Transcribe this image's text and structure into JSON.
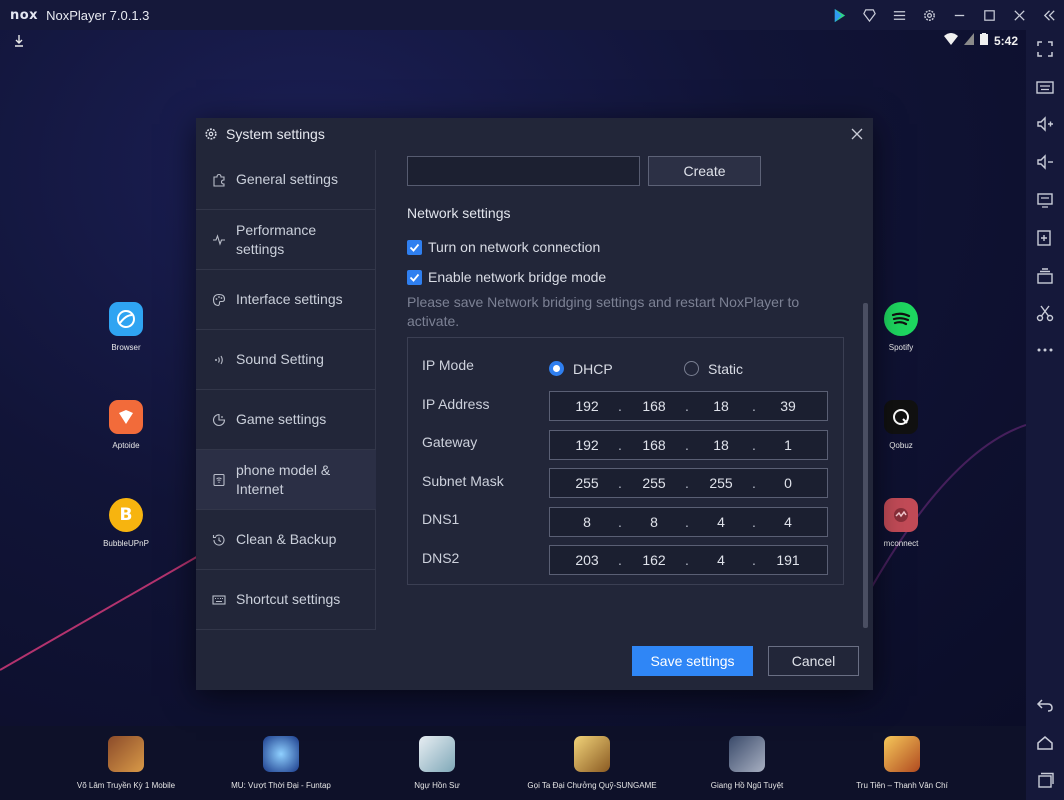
{
  "window": {
    "logo": "nox",
    "title": "NoxPlayer 7.0.1.3",
    "controls": [
      "play-store-icon",
      "pin-icon",
      "menu-icon",
      "gear-icon",
      "minimize-icon",
      "maximize-icon",
      "close-icon",
      "collapse-icon"
    ]
  },
  "status": {
    "time": "5:42"
  },
  "desktop_icons": {
    "left": [
      {
        "label": "Browser",
        "icon": "browser-icon",
        "color": "#2fa4f2"
      },
      {
        "label": "Aptoide",
        "icon": "aptoide-icon",
        "color": "#f26b3a"
      },
      {
        "label": "BubbleUPnP",
        "icon": "bubbleupnp-icon",
        "color": "#f7b40f"
      }
    ],
    "right": [
      {
        "label": "Spotify",
        "icon": "spotify-icon",
        "color": "#1ed760"
      },
      {
        "label": "Qobuz",
        "icon": "qobuz-icon",
        "color": "#111111"
      },
      {
        "label": "mconnect",
        "icon": "mconnect-icon",
        "color": "#c24b57"
      }
    ]
  },
  "dock": {
    "games": [
      {
        "label": "Võ Lâm Truyền Kỳ 1 Mobile"
      },
      {
        "label": "MU: Vượt Thời Đại - Funtap"
      },
      {
        "label": "Ngự Hồn Sư"
      },
      {
        "label": "Gọi Ta Đại Chưởng Quỹ-SUNGAME"
      },
      {
        "label": "Giang Hồ Ngũ Tuyệt"
      },
      {
        "label": "Tru Tiên – Thanh Vân Chí"
      }
    ]
  },
  "dialog": {
    "title": "System settings",
    "nav": [
      {
        "label": "General settings",
        "icon": "puzzle-icon"
      },
      {
        "label": "Performance settings",
        "icon": "pulse-icon"
      },
      {
        "label": "Interface settings",
        "icon": "palette-icon"
      },
      {
        "label": "Sound Setting",
        "icon": "sound-icon"
      },
      {
        "label": "Game settings",
        "icon": "gamepad-icon"
      },
      {
        "label": "phone model & Internet",
        "icon": "phone-icon",
        "active": true
      },
      {
        "label": "Clean & Backup",
        "icon": "history-icon"
      },
      {
        "label": "Shortcut settings",
        "icon": "keyboard-icon"
      }
    ],
    "create_input_value": "",
    "create_label": "Create",
    "network": {
      "section_title": "Network settings",
      "connection_label": "Turn on network connection",
      "connection_checked": true,
      "bridge_label": "Enable network bridge mode",
      "bridge_checked": true,
      "hint": "Please save Network bridging settings and restart NoxPlayer to activate.",
      "ip_mode_label": "IP Mode",
      "dhcp_label": "DHCP",
      "static_label": "Static",
      "selected_mode": "DHCP",
      "fields": [
        {
          "label": "IP Address",
          "octets": [
            "192",
            "168",
            "18",
            "39"
          ]
        },
        {
          "label": "Gateway",
          "octets": [
            "192",
            "168",
            "18",
            "1"
          ]
        },
        {
          "label": "Subnet Mask",
          "octets": [
            "255",
            "255",
            "255",
            "0"
          ]
        },
        {
          "label": "DNS1",
          "octets": [
            "8",
            "8",
            "4",
            "4"
          ]
        },
        {
          "label": "DNS2",
          "octets": [
            "203",
            "162",
            "4",
            "191"
          ]
        }
      ]
    },
    "save_label": "Save settings",
    "cancel_label": "Cancel"
  },
  "colors": {
    "accent": "#2f86f6",
    "dialog_bg": "#222639",
    "desktop_bg": "#111437"
  }
}
